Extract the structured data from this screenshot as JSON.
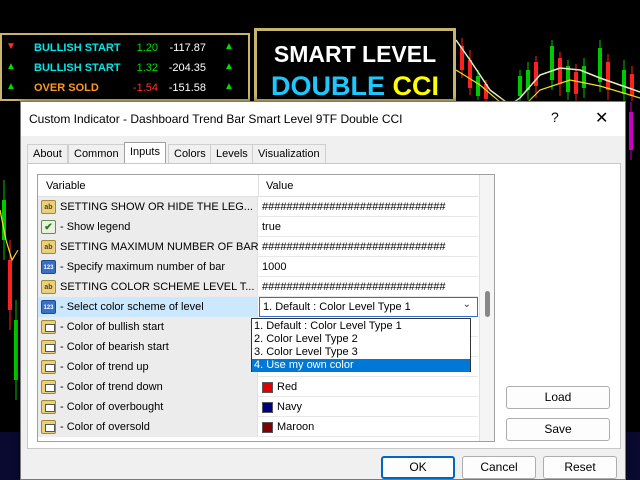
{
  "dashboard": {
    "rows": [
      {
        "label": "BULLISH START",
        "v1": "1.20",
        "v2": "-117.87",
        "arrow": "▲",
        "label_color": "#00e6e6",
        "v1_color": "#00dd00",
        "arrow_color": "#00dd00"
      },
      {
        "label": "BULLISH START",
        "v1": "1.32",
        "v2": "-204.35",
        "arrow": "▲",
        "label_color": "#00e6e6",
        "v1_color": "#00dd00",
        "arrow_color": "#00dd00"
      },
      {
        "label": "OVER SOLD",
        "v1": "-1.54",
        "v2": "-151.58",
        "arrow": "▲",
        "label_color": "#ff9a1e",
        "v1_color": "#ff3030",
        "arrow_color": "#00dd00"
      }
    ],
    "left_arrows": [
      "▼",
      "▲",
      "▲"
    ]
  },
  "title_panel": {
    "line1": "SMART LEVEL",
    "line2_a": "DOUBLE",
    "line2_b": "CCI"
  },
  "dialog": {
    "title": "Custom Indicator - Dashboard Trend Bar Smart Level 9TF Double CCI",
    "help_glyph": "?",
    "close_glyph": "✕",
    "tabs": [
      "About",
      "Common",
      "Inputs",
      "Colors",
      "Levels",
      "Visualization"
    ],
    "active_tab": "Inputs",
    "columns": {
      "variable": "Variable",
      "value": "Value"
    },
    "rows": [
      {
        "icon": "ab",
        "name": "SETTING SHOW OR HIDE THE LEG...",
        "value": "##############################"
      },
      {
        "icon": "bool",
        "name": "- Show legend",
        "value": "true"
      },
      {
        "icon": "ab",
        "name": "SETTING MAXIMUM NUMBER OF BAR",
        "value": "##############################"
      },
      {
        "icon": "123",
        "name": "- Specify maximum number of bar",
        "value": "1000"
      },
      {
        "icon": "ab",
        "name": "SETTING COLOR SCHEME LEVEL T...",
        "value": "##############################"
      },
      {
        "icon": "123",
        "name": "- Select color scheme of level",
        "value": "1. Default : Color Level Type 1"
      },
      {
        "icon": "color",
        "name": "- Color of bullish start",
        "value": ""
      },
      {
        "icon": "color",
        "name": "- Color of bearish start",
        "value": ""
      },
      {
        "icon": "color",
        "name": "- Color of trend up",
        "value": ""
      },
      {
        "icon": "color",
        "name": "- Color of trend down",
        "value": "Red",
        "swatch": "#e00000"
      },
      {
        "icon": "color",
        "name": "- Color of overbought",
        "value": "Navy",
        "swatch": "#000080"
      },
      {
        "icon": "color",
        "name": "- Color of oversold",
        "value": "Maroon",
        "swatch": "#800000"
      }
    ],
    "dropdown": {
      "options": [
        "1. Default : Color Level Type 1",
        "2. Color Level Type 2",
        "3. Color Level Type 3",
        "4. Use my own color"
      ],
      "highlighted": 3
    },
    "buttons": {
      "load": "Load",
      "save": "Save",
      "ok": "OK",
      "cancel": "Cancel",
      "reset": "Reset"
    }
  },
  "colors": {
    "accent": "#0078d7",
    "panel_border": "#c8b46a"
  }
}
